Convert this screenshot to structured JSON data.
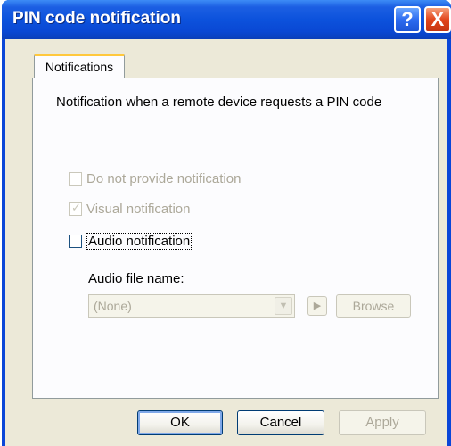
{
  "window": {
    "title": "PIN code notification",
    "help_glyph": "?",
    "close_glyph": "X"
  },
  "tabs": [
    {
      "label": "Notifications",
      "selected": true
    }
  ],
  "panel": {
    "heading": "Notification when a remote device requests a PIN code",
    "options": [
      {
        "label": "Do not provide notification",
        "checked": false,
        "enabled": false
      },
      {
        "label": "Visual notification",
        "checked": true,
        "enabled": false
      },
      {
        "label": "Audio notification",
        "checked": false,
        "enabled": true,
        "focused": true
      }
    ],
    "audio_file_label": "Audio file name:",
    "audio_file_value": "(None)",
    "browse_label": "Browse"
  },
  "buttons": {
    "ok": "OK",
    "cancel": "Cancel",
    "apply": "Apply"
  },
  "colors": {
    "titlebar": "#0a48d4",
    "dialog_bg": "#ece9d8",
    "tab_highlight": "#ffc83c",
    "close_button": "#e2461c"
  }
}
